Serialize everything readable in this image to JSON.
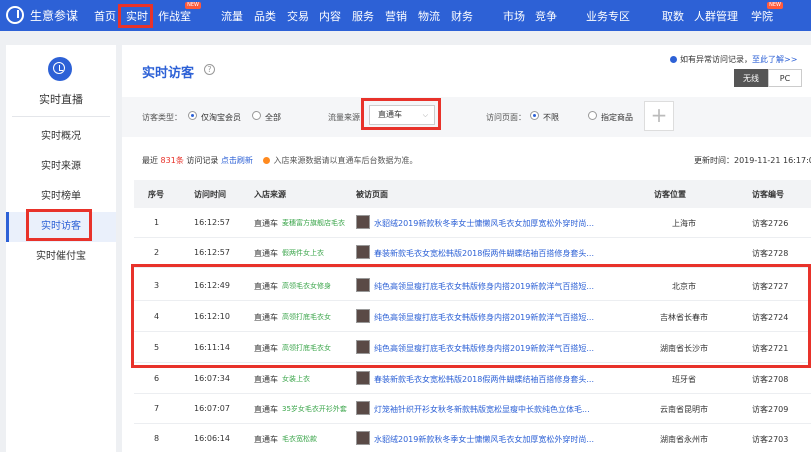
{
  "topnav": {
    "logo": "生意参谋",
    "items": [
      {
        "label": "首页"
      },
      {
        "label": "实时"
      },
      {
        "label": "作战室",
        "badge": "NEW"
      },
      {
        "label": "流量"
      },
      {
        "label": "品类"
      },
      {
        "label": "交易"
      },
      {
        "label": "内容"
      },
      {
        "label": "服务"
      },
      {
        "label": "营销"
      },
      {
        "label": "物流"
      },
      {
        "label": "财务"
      },
      {
        "label": "市场"
      },
      {
        "label": "竞争"
      },
      {
        "label": "业务专区"
      },
      {
        "label": "取数"
      },
      {
        "label": "人群管理"
      },
      {
        "label": "学院",
        "badge": "NEW"
      }
    ]
  },
  "sidebar": {
    "title": "实时直播",
    "items": [
      {
        "label": "实时概况"
      },
      {
        "label": "实时来源"
      },
      {
        "label": "实时榜单"
      },
      {
        "label": "实时访客",
        "active": true
      },
      {
        "label": "实时催付宝"
      }
    ]
  },
  "main": {
    "title": "实时访客",
    "notice": {
      "text": "如有异常访问记录，",
      "link": "至此了解>>"
    },
    "device_tabs": [
      "无线",
      "PC"
    ],
    "filters": {
      "visitor_type_label": "访客类型：",
      "visitor_type_options": [
        "仅淘宝会员",
        "全部"
      ],
      "traffic_source_label": "流量来源",
      "traffic_source_value": "直通车",
      "visit_page_label": "访问页面：",
      "visit_page_options": [
        "不限",
        "指定商品"
      ]
    },
    "summary": {
      "prefix": "最近",
      "count": "831条",
      "suffix": "访问记录",
      "refresh": "点击刷新",
      "warning": "入店来源数据请以直通车后台数据为准。"
    },
    "update_time": "更新时间：2019-11-21 16:17:0",
    "table": {
      "headers": [
        "序号",
        "访问时间",
        "入店来源",
        "被访页面",
        "访客位置",
        "访客编号"
      ],
      "rows": [
        {
          "seq": "1",
          "time": "16:12:57",
          "source": "直通车",
          "keyword": "麦穗富方旗舰店毛衣",
          "page": "水貂绒2019新款秋冬季女士慵懒风毛衣女加厚宽松外穿时尚...",
          "location": "上海市",
          "visitor": "访客2726"
        },
        {
          "seq": "2",
          "time": "16:12:57",
          "source": "直通车",
          "keyword": "假两件女上衣",
          "page": "春装新款毛衣女宽松韩版2018假两件蝴蝶结袖百搭修身套头...",
          "location": "",
          "visitor": "访客2728"
        },
        {
          "seq": "3",
          "time": "16:12:49",
          "source": "直通车",
          "keyword": "高领毛衣女修身",
          "page": "纯色高领显瘦打底毛衣女韩版修身内搭2019新款洋气百搭短...",
          "location": "北京市",
          "visitor": "访客2727"
        },
        {
          "seq": "4",
          "time": "16:12:10",
          "source": "直通车",
          "keyword": "高领打底毛衣女",
          "page": "纯色高领显瘦打底毛衣女韩版修身内搭2019新款洋气百搭短...",
          "location": "吉林省长春市",
          "visitor": "访客2724"
        },
        {
          "seq": "5",
          "time": "16:11:14",
          "source": "直通车",
          "keyword": "高领打底毛衣女",
          "page": "纯色高领显瘦打底毛衣女韩版修身内搭2019新款洋气百搭短...",
          "location": "湖南省长沙市",
          "visitor": "访客2721"
        },
        {
          "seq": "6",
          "time": "16:07:34",
          "source": "直通车",
          "keyword": "女装上衣",
          "page": "春装新款毛衣女宽松韩版2018假两件蝴蝶结袖百搭修身套头...",
          "location": "班牙省",
          "visitor": "访客2708"
        },
        {
          "seq": "7",
          "time": "16:07:07",
          "source": "直通车",
          "keyword": "35岁女毛衣开衫外套",
          "page": "灯笼袖针织开衫女秋冬新款韩版宽松显瘦中长款纯色立体毛...",
          "location": "云南省昆明市",
          "visitor": "访客2709"
        },
        {
          "seq": "8",
          "time": "16:06:14",
          "source": "直通车",
          "keyword": "毛衣宽松款",
          "page": "水貂绒2019新款秋冬季女士慵懒风毛衣女加厚宽松外穿时尚...",
          "location": "湖南省永州市",
          "visitor": "访客2703"
        }
      ]
    }
  },
  "colors": {
    "brand": "#2d61d6",
    "highlight": "#e8322a",
    "keyword": "#3aa54a"
  }
}
